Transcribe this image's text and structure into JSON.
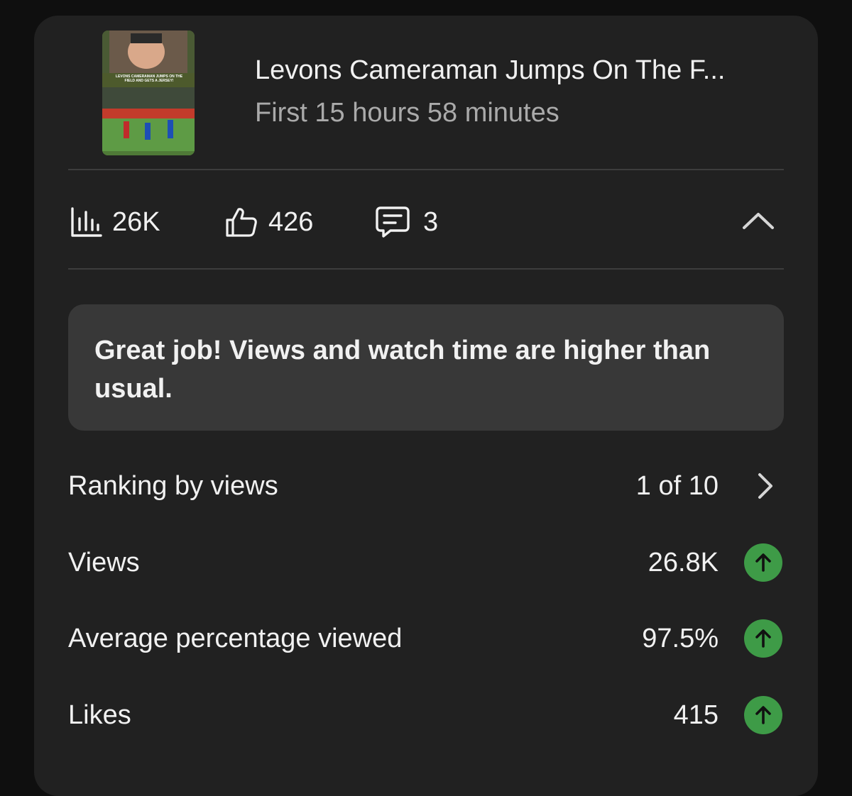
{
  "video": {
    "title": "Levons Cameraman Jumps On The F...",
    "subtitle": "First 15 hours 58 minutes",
    "thumbnail_caption": "LEVONS CAMERAMAN JUMPS ON THE FIELD AND GETS A JERSEY!"
  },
  "stats": {
    "views": "26K",
    "likes": "426",
    "comments": "3",
    "views_icon": "bar-chart-icon",
    "likes_icon": "thumbs-up-icon",
    "comments_icon": "comment-icon",
    "collapse_icon": "chevron-up-icon"
  },
  "banner": {
    "text": "Great job! Views and watch time are higher than usual."
  },
  "metrics": [
    {
      "label": "Ranking by views",
      "value": "1 of 10",
      "indicator": "chevron-right-icon"
    },
    {
      "label": "Views",
      "value": "26.8K",
      "indicator": "arrow-up-icon"
    },
    {
      "label": "Average percentage viewed",
      "value": "97.5%",
      "indicator": "arrow-up-icon"
    },
    {
      "label": "Likes",
      "value": "415",
      "indicator": "arrow-up-icon"
    }
  ],
  "colors": {
    "background": "#0f0f0f",
    "card": "#212121",
    "banner": "#383838",
    "positive": "#3e9b47",
    "secondary_text": "#aaaaaa"
  }
}
